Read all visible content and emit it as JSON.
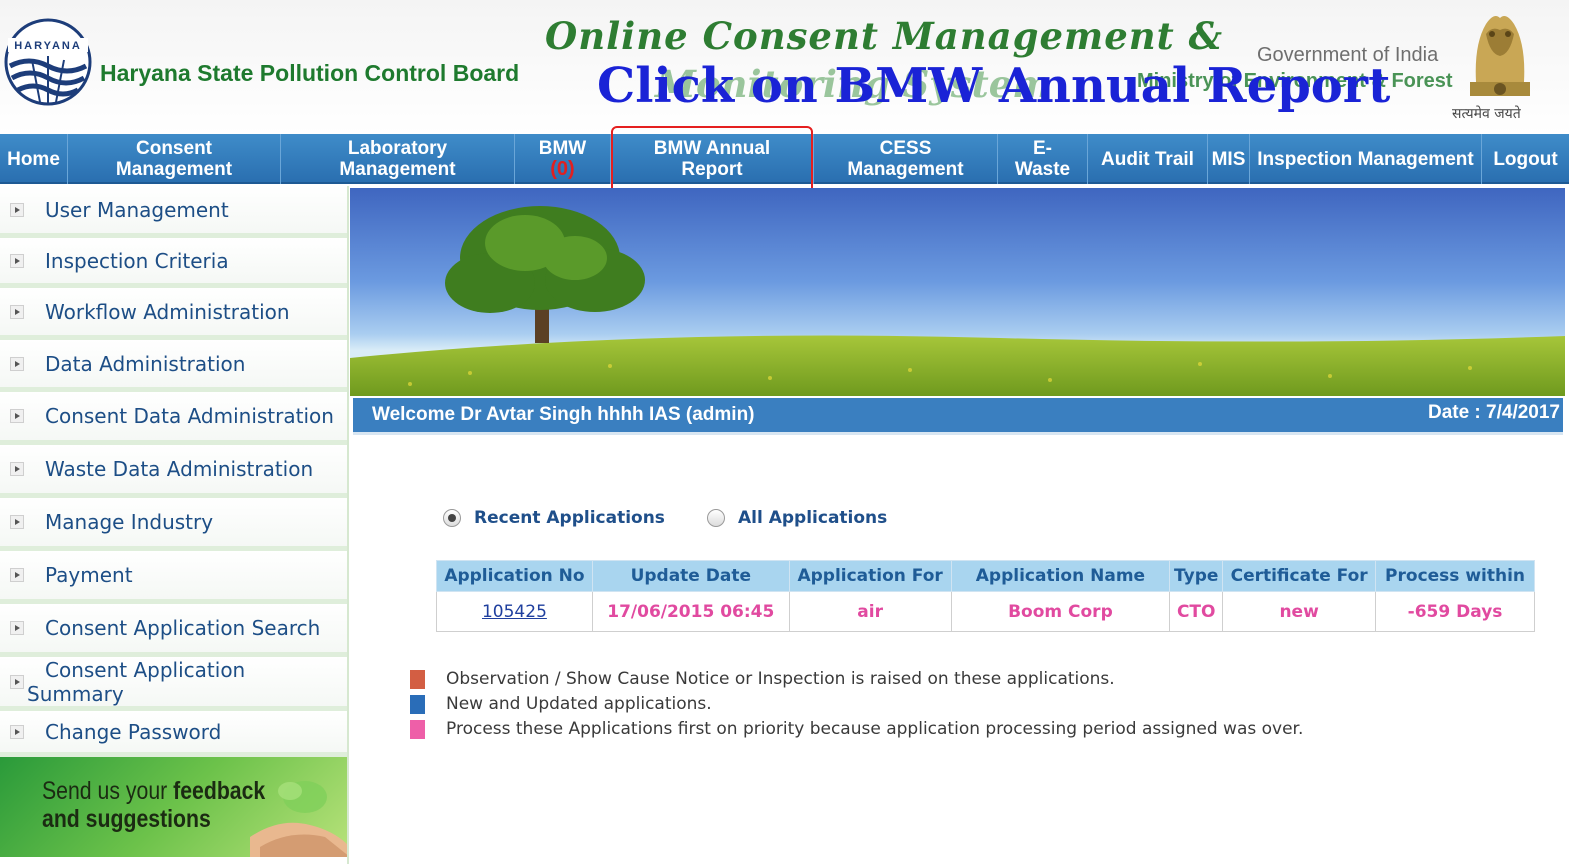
{
  "header": {
    "logo_text": "HARYANA",
    "board_name": "Haryana State Pollution Control Board",
    "title_line1": "Online Consent Management &",
    "title_line2": "Monitoring System",
    "gov_line1": "Government of India",
    "gov_line2": "Ministry of Environment & Forest",
    "motto": "सत्यमेव जयते",
    "instruction_overlay": "Click on BMW Annual Report"
  },
  "nav": {
    "items": [
      {
        "label": "Home"
      },
      {
        "label": "Consent Management"
      },
      {
        "label": "Laboratory Management"
      },
      {
        "label": "BMW",
        "count": "(0)"
      },
      {
        "label": "BMW Annual Report"
      },
      {
        "label": "CESS Management"
      },
      {
        "label": "E-Waste"
      },
      {
        "label": "Audit Trail"
      },
      {
        "label": "MIS"
      },
      {
        "label": "Inspection Management"
      },
      {
        "label": "Logout"
      }
    ],
    "highlight_color": "#e51f1f"
  },
  "sidebar": {
    "items": [
      {
        "label": "User Management"
      },
      {
        "label": "Inspection Criteria"
      },
      {
        "label": "Workflow Administration"
      },
      {
        "label": "Data Administration"
      },
      {
        "label": "Consent Data Administration"
      },
      {
        "label": "Waste Data Administration"
      },
      {
        "label": "Manage Industry"
      },
      {
        "label": "Payment"
      },
      {
        "label": "Consent Application Search"
      },
      {
        "label": "Consent Application Summary"
      },
      {
        "label": "Change Password"
      }
    ],
    "feedback": {
      "line1_prefix": "Send us your ",
      "line1_bold": "feedback",
      "line2": "and suggestions"
    }
  },
  "welcome": {
    "text": "Welcome Dr Avtar Singh hhhh IAS (admin)",
    "date": "Date : 7/4/2017"
  },
  "filters": {
    "recent": "Recent Applications",
    "all": "All Applications",
    "selected": "recent"
  },
  "table": {
    "headers": [
      "Application No",
      "Update Date",
      "Application For",
      "Application Name",
      "Type",
      "Certificate For",
      "Process within"
    ],
    "rows": [
      [
        "105425",
        "17/06/2015 06:45",
        "air",
        "Boom Corp",
        "CTO",
        "new",
        "-659 Days"
      ]
    ]
  },
  "legend": {
    "items": [
      {
        "color": "#d35e43",
        "text": "Observation / Show Cause Notice or Inspection is raised on these applications."
      },
      {
        "color": "#2a6db8",
        "text": "New and Updated applications."
      },
      {
        "color": "#ee5fa8",
        "text": "Process these Applications first on priority because application processing period assigned was over."
      }
    ]
  },
  "colors": {
    "nav_blue": "#2f7bbf",
    "welcome_blue": "#3a7fc0",
    "table_header_bg": "#a9d5ef",
    "priority_pink": "#e14aa0",
    "instruction_blue": "#1a23d6"
  }
}
